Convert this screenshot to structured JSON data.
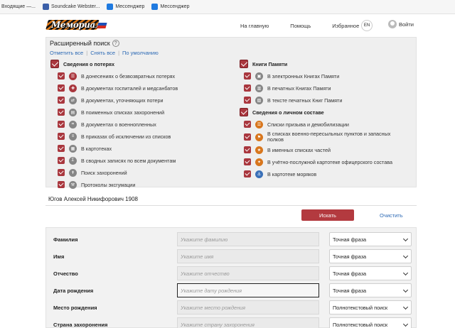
{
  "bookmarks": [
    {
      "label": "Входящие —...",
      "icon": "mail-icon"
    },
    {
      "label": "Soundcake Webster...",
      "icon": "bookmark-icon"
    },
    {
      "label": "Мессенджер",
      "icon": "messenger-icon"
    },
    {
      "label": "Мессенджер",
      "icon": "messenger-icon"
    }
  ],
  "header": {
    "logo_text": "Мемориал",
    "nav": [
      "На главную",
      "Помощь",
      "Избранное"
    ],
    "lang": "EN",
    "login": "Войти"
  },
  "advanced": {
    "title": "Расширенный поиск",
    "help": "?",
    "quick": [
      "Отметить все",
      "Снять все",
      "По умолчанию"
    ],
    "left_group": "Сведения о потерях",
    "left_items": [
      "В донесениях о безвозвратных потерях",
      "В документах госпиталей и медсанбатов",
      "В документах, уточняющих потери",
      "В поименных списках захоронений",
      "В документах о военнопленных",
      "В приказах об исключении из списков",
      "В картотеках",
      "В сводных записях по всем документам",
      "Поиск захоронений",
      "Протоколы эксгумации"
    ],
    "right_group1": "Книги Памяти",
    "right_items1": [
      "В электронных Книгах Памяти",
      "В печатных Книгах Памяти",
      "В тексте печатных Книг Памяти"
    ],
    "right_group2": "Сведения о личном составе",
    "right_items2": [
      "Списки призыва и демобилизации",
      "В списках военно-пересыльных пунктов и запасных полков",
      "В именных списках частей",
      "В учётно-послужной картотеке офицерского состава",
      "В картотеке моряков"
    ]
  },
  "query": "Югов Алексей Никифорович 1908",
  "buttons": {
    "search": "Искать",
    "clear": "Очистить"
  },
  "form": [
    {
      "label": "Фамилия",
      "placeholder": "Укажите фамилию",
      "mode": "Точная фраза"
    },
    {
      "label": "Имя",
      "placeholder": "Укажите имя",
      "mode": "Точная фраза"
    },
    {
      "label": "Отчество",
      "placeholder": "Укажите отчество",
      "mode": "Точная фраза"
    },
    {
      "label": "Дата рождения",
      "placeholder": "Укажите дату рождения",
      "mode": "Точная фраза"
    },
    {
      "label": "Место рождения",
      "placeholder": "Укажите место рождения",
      "mode": "Полнотекстовый поиск"
    },
    {
      "label": "Страна захоронения",
      "placeholder": "Укажите страну захоронения",
      "mode": "Полнотекстовый поиск"
    }
  ],
  "colors": {
    "accent": "#a9373e",
    "link": "#2d6ab5",
    "panel": "#efefef"
  }
}
